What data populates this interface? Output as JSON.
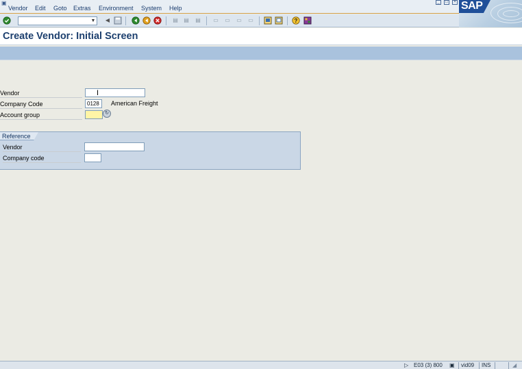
{
  "menu": {
    "items": [
      {
        "label": "Vendor"
      },
      {
        "label": "Edit"
      },
      {
        "label": "Goto"
      },
      {
        "label": "Extras"
      },
      {
        "label": "Environment"
      },
      {
        "label": "System"
      },
      {
        "label": "Help"
      }
    ]
  },
  "logo": {
    "text": "SAP"
  },
  "toolbar": {
    "command_field_value": "",
    "icons": [
      "enter-icon",
      "back-icon",
      "exit-icon",
      "cancel-icon",
      "print-icon",
      "find-icon",
      "find-next-icon",
      "first-page-icon",
      "previous-page-icon",
      "next-page-icon",
      "last-page-icon",
      "create-session-icon",
      "shortcut-icon",
      "help-icon",
      "customize-layout-icon"
    ]
  },
  "title": "Create Vendor: Initial Screen",
  "form": {
    "vendor": {
      "label": "Vendor",
      "value": ""
    },
    "company_code": {
      "label": "Company Code",
      "value": "0128",
      "description": "American Freight"
    },
    "account_group": {
      "label": "Account group",
      "value": ""
    }
  },
  "reference": {
    "title": "Reference",
    "vendor": {
      "label": "Vendor",
      "value": ""
    },
    "company_code": {
      "label": "Company code",
      "value": ""
    }
  },
  "status": {
    "system": "E03 (3) 800",
    "server": "vid09",
    "mode": "INS"
  },
  "colors": {
    "title": "#1c3f6e",
    "app_toolbar": "#a9c2dd",
    "background": "#ebebe4",
    "required_field": "#fff5a6",
    "group_box": "#cad7e6"
  }
}
